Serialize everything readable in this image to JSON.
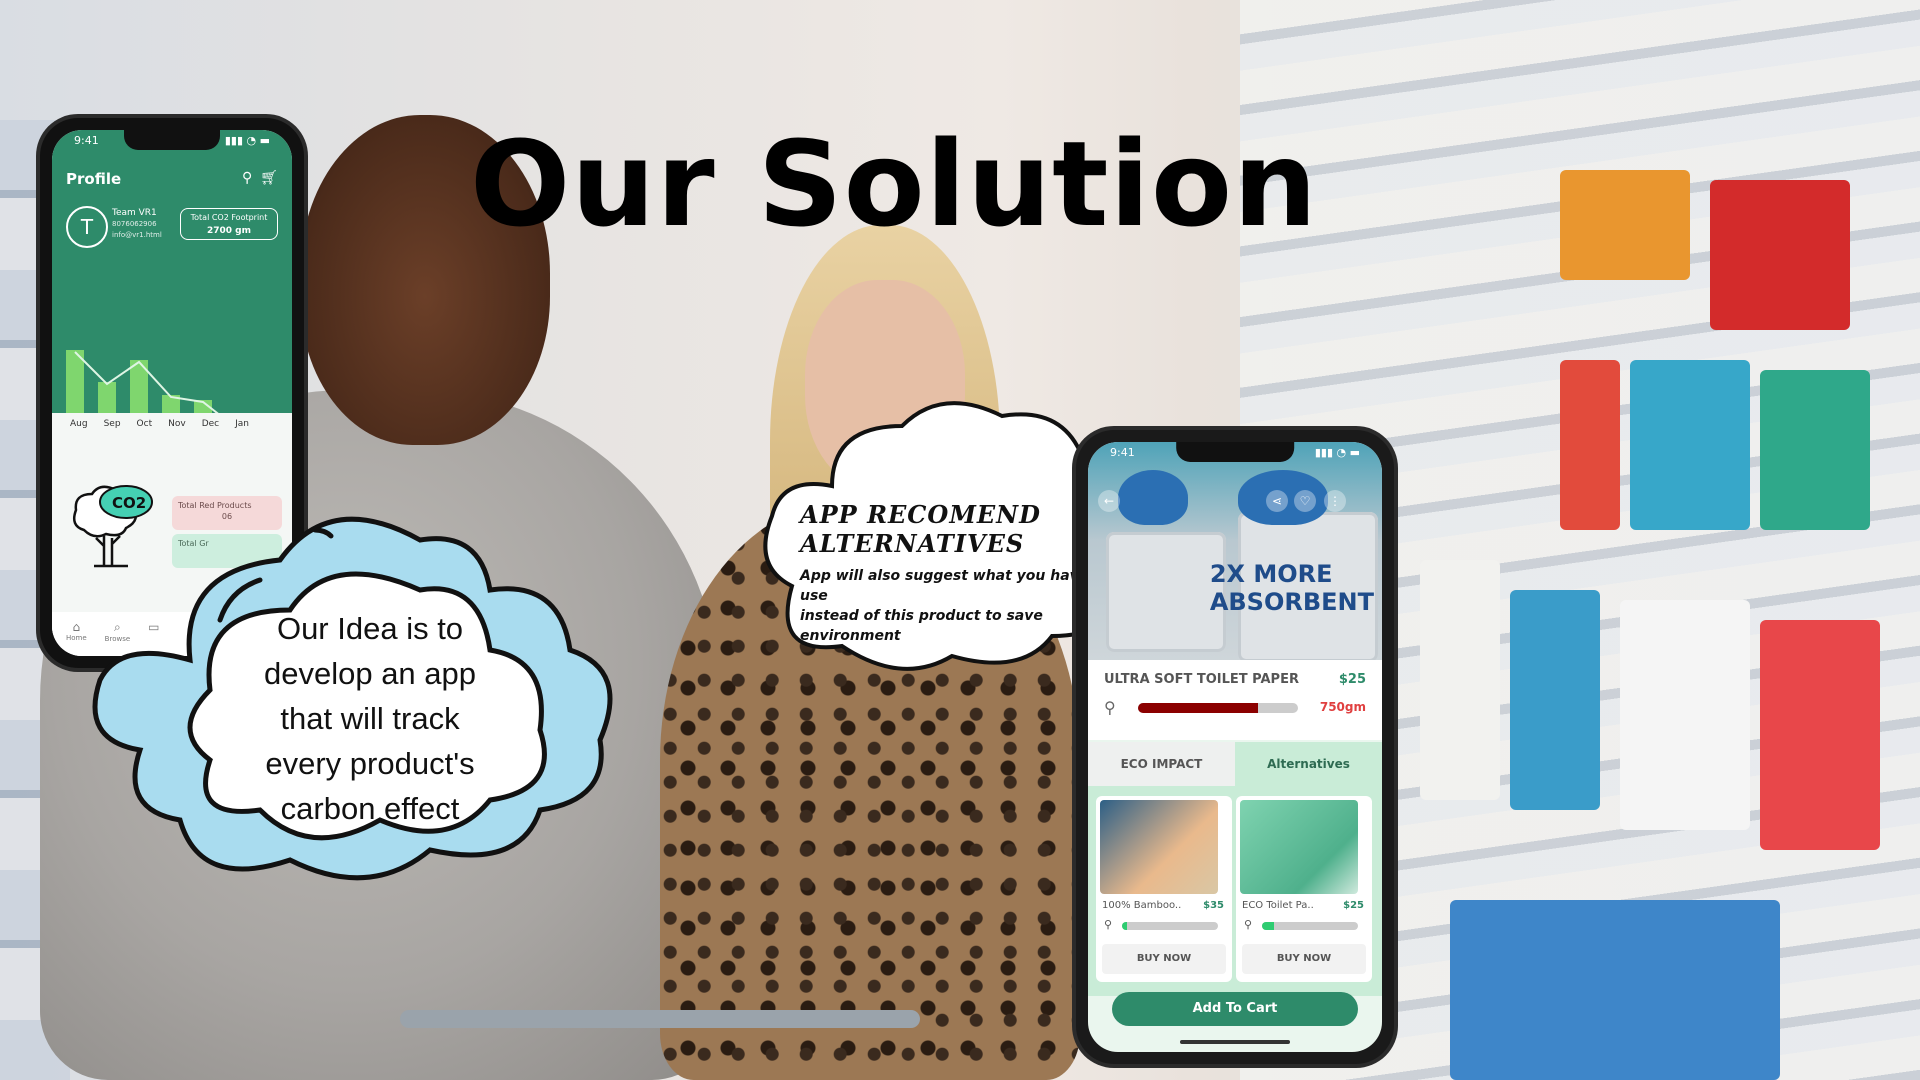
{
  "title": "Our Solution",
  "profile_phone": {
    "status_time": "9:41",
    "header": "Profile",
    "avatar_letter": "T",
    "user_name": "Team VR1",
    "user_phone": "8076062906",
    "user_email": "info@vr1.html",
    "footprint_label": "Total CO2 Footprint",
    "footprint_value": "2700 gm",
    "chart_months": [
      "Aug",
      "Sep",
      "Oct",
      "Nov",
      "Dec",
      "Jan"
    ],
    "co2_badge": "CO2",
    "red_products_label": "Total Red Products",
    "red_products_value": "06",
    "green_label": "Total Gr",
    "nav": [
      "Home",
      "Browse",
      ""
    ]
  },
  "product_phone": {
    "status_time": "9:41",
    "hero_text_line1": "2X MORE",
    "hero_text_line2": "ABSORBENT",
    "product_name": "ULTRA SOFT TOILET PAPER",
    "product_price": "$25",
    "carbon_value": "750gm",
    "carbon_level": 0.75,
    "tabs": [
      "ECO IMPACT",
      "Alternatives"
    ],
    "alternatives": [
      {
        "name": "100% Bamboo..",
        "price": "$35",
        "level": 0.05,
        "buy": "BUY NOW"
      },
      {
        "name": "ECO Toilet Pa..",
        "price": "$25",
        "level": 0.12,
        "buy": "BUY NOW"
      }
    ],
    "cart_button": "Add To Cart"
  },
  "cloud_idea": {
    "lines": [
      "Our Idea is to",
      "develop an app",
      "that will track",
      "every product's",
      "carbon effect"
    ]
  },
  "cloud_recommend": {
    "title_line1": "APP RECOMEND",
    "title_line2": "ALTERNATIVES",
    "body_line1": "App will also suggest what you have to use",
    "body_line2": "instead of this product to save environment"
  }
}
